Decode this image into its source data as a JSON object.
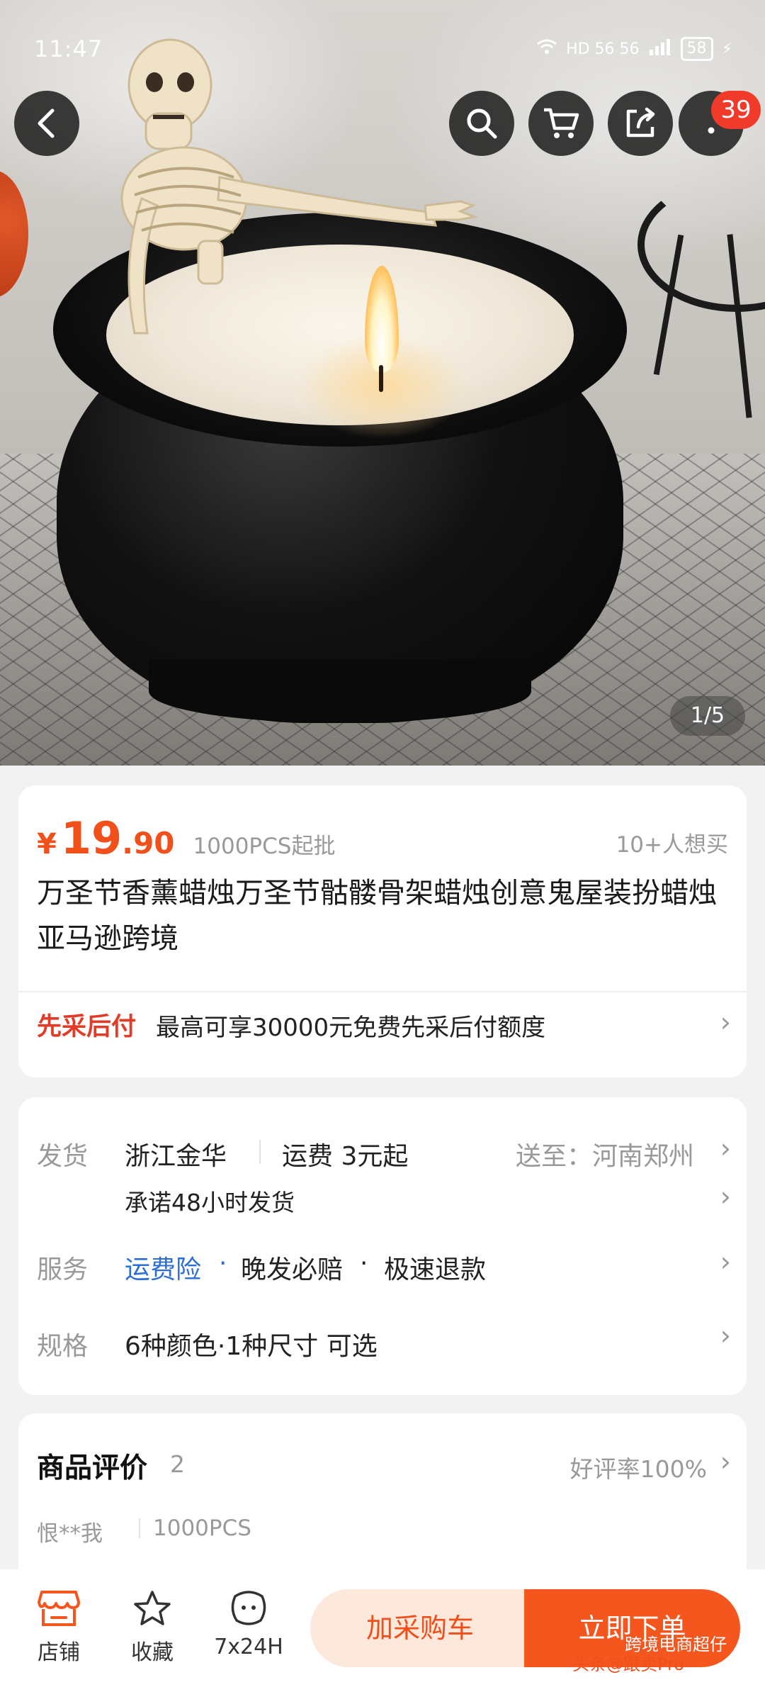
{
  "status_bar": {
    "time": "11:47",
    "network": "HD 56 56",
    "battery": "58"
  },
  "nav": {
    "cart_badge": "39"
  },
  "gallery": {
    "pager": "1/5"
  },
  "product": {
    "currency": "¥",
    "price_int": "19",
    "price_dec": ".90",
    "moq": "1000PCS起批",
    "want": "10+人想买",
    "title": "万圣节香薰蜡烛万圣节骷髅骨架蜡烛创意鬼屋装扮蜡烛亚马逊跨境"
  },
  "bnpl": {
    "tag": "先采后付",
    "text": "最高可享30000元免费先采后付额度"
  },
  "shipping": {
    "label": "发货",
    "origin": "浙江金华",
    "fee": "运费 3元起",
    "deliver_to": "送至：河南郑州",
    "promise": "承诺48小时发货"
  },
  "service": {
    "label": "服务",
    "items": [
      "运费险",
      "晚发必赔",
      "极速退款"
    ],
    "sep": "·"
  },
  "spec": {
    "label": "规格",
    "text": "6种颜色·1种尺寸 可选"
  },
  "reviews": {
    "title": "商品评价",
    "count": "2",
    "rate": "好评率100%",
    "first_user": "恨**我",
    "first_spec": "1000PCS"
  },
  "bottom": {
    "tabs": [
      {
        "label": "店铺",
        "icon": "store-icon"
      },
      {
        "label": "收藏",
        "icon": "star-icon"
      },
      {
        "label": "7x24H",
        "icon": "service-icon"
      }
    ],
    "cart_button": "加采购车",
    "buy_button": "立即下单"
  },
  "watermark": {
    "text": "头条@跟卖Pro",
    "text2": "跨境电商超仔"
  },
  "colors": {
    "accent": "#f5561e",
    "price": "#f2501b",
    "link": "#2b6fd6",
    "tag": "#e23c28"
  }
}
